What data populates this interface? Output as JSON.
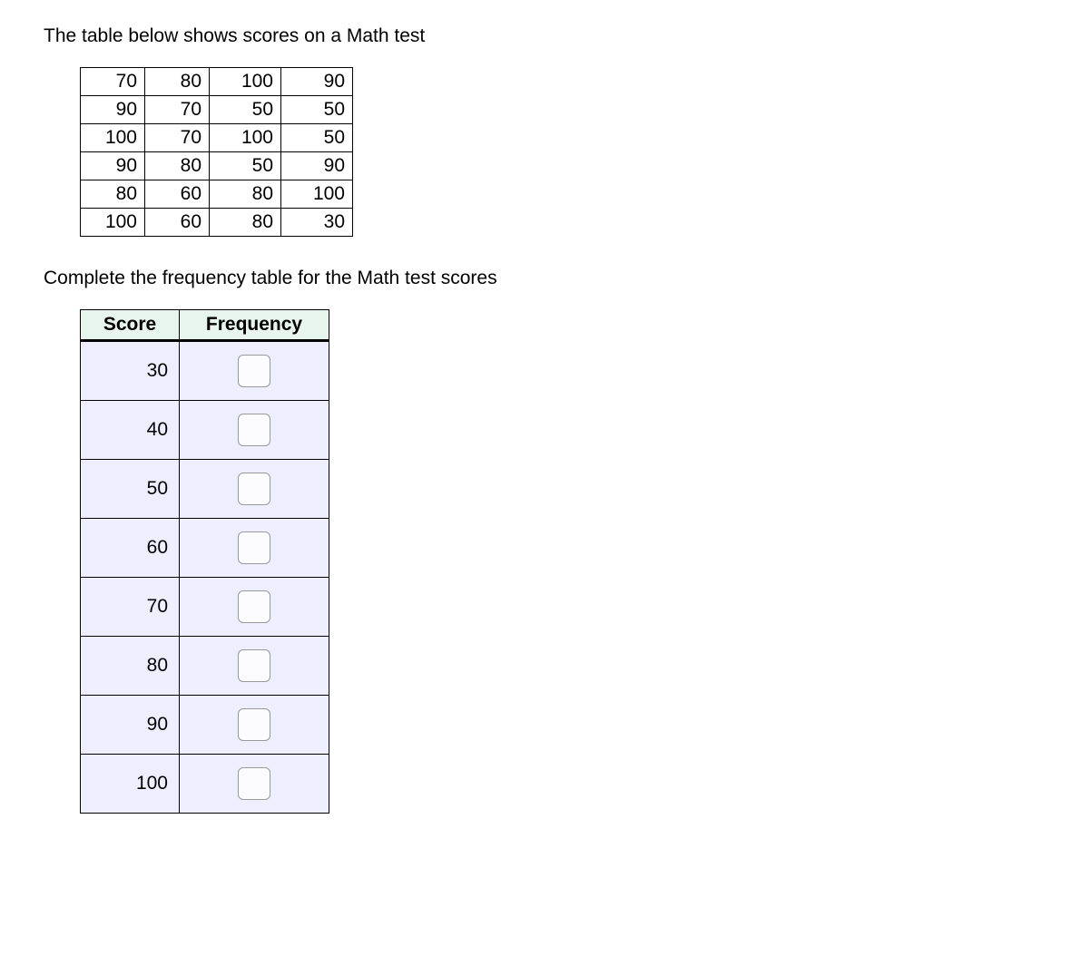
{
  "intro_text": "The table below shows scores on a Math test",
  "scores_table": {
    "rows": [
      [
        70,
        80,
        100,
        90
      ],
      [
        90,
        70,
        50,
        50
      ],
      [
        100,
        70,
        100,
        50
      ],
      [
        90,
        80,
        50,
        90
      ],
      [
        80,
        60,
        80,
        100
      ],
      [
        100,
        60,
        80,
        30
      ]
    ]
  },
  "instruction_text": "Complete the frequency table for the Math test scores",
  "frequency_table": {
    "headers": {
      "score": "Score",
      "frequency": "Frequency"
    },
    "rows": [
      {
        "score": 30,
        "frequency": ""
      },
      {
        "score": 40,
        "frequency": ""
      },
      {
        "score": 50,
        "frequency": ""
      },
      {
        "score": 60,
        "frequency": ""
      },
      {
        "score": 70,
        "frequency": ""
      },
      {
        "score": 80,
        "frequency": ""
      },
      {
        "score": 90,
        "frequency": ""
      },
      {
        "score": 100,
        "frequency": ""
      }
    ]
  }
}
